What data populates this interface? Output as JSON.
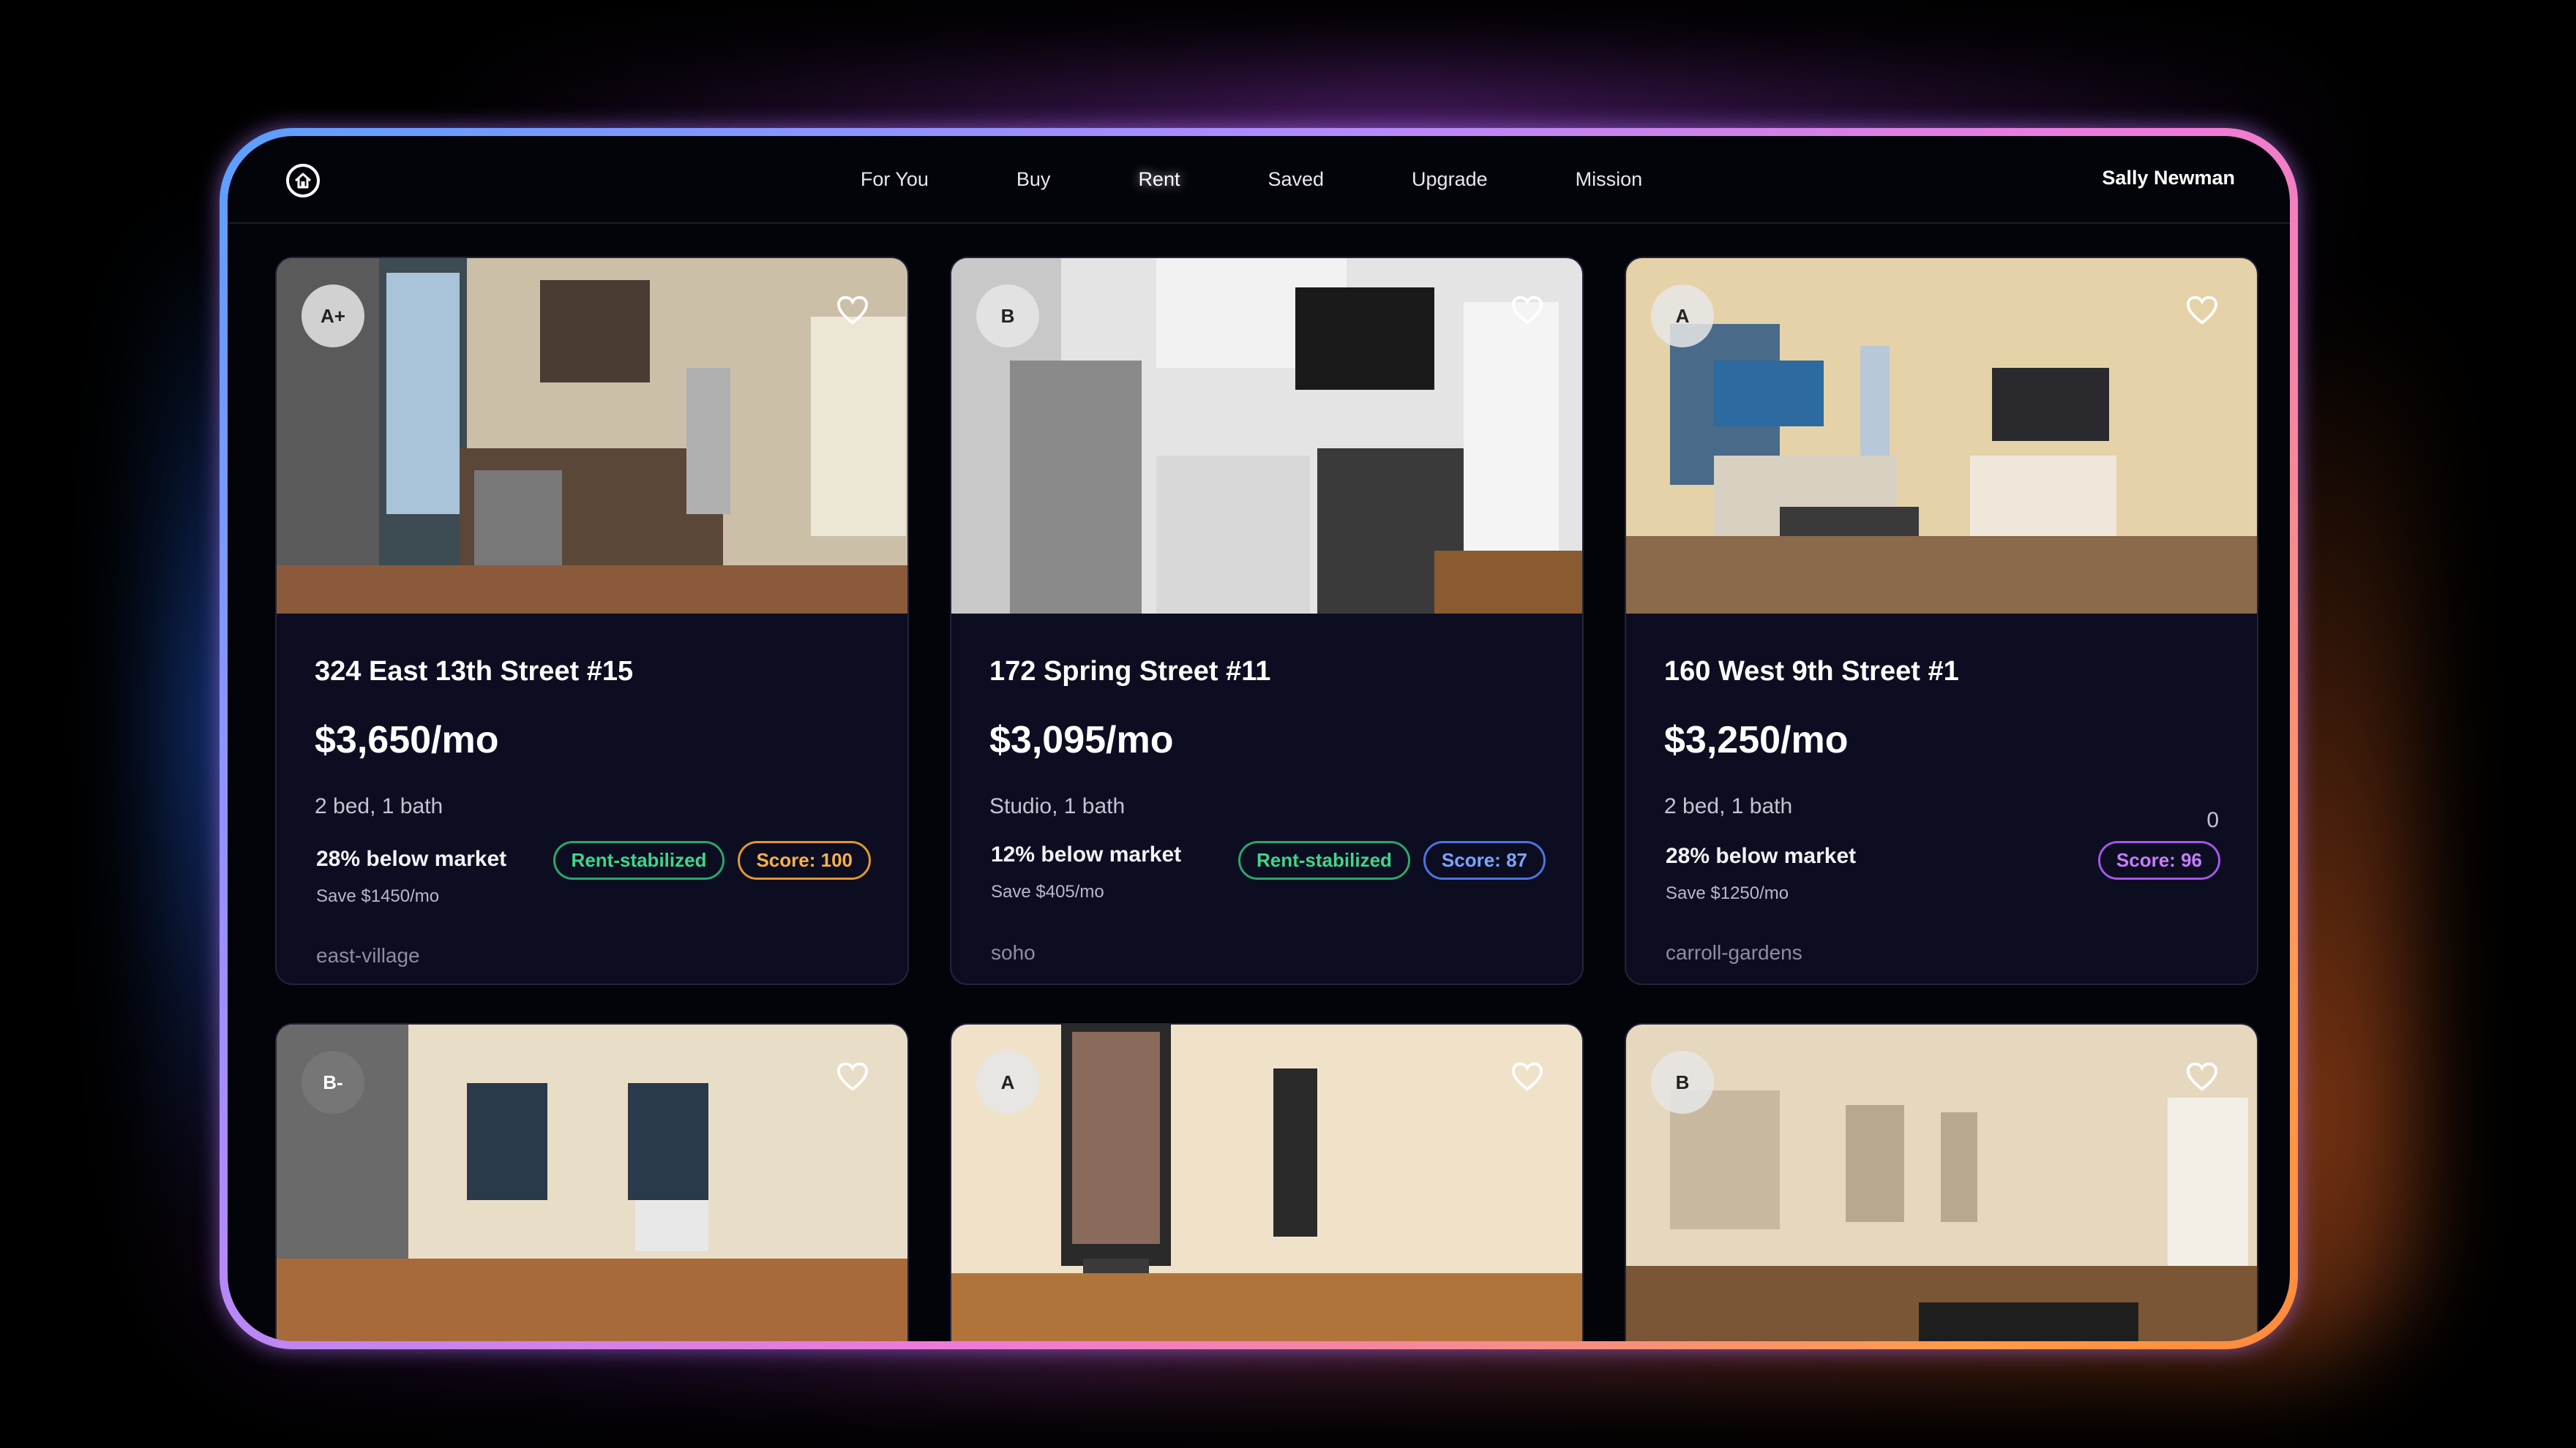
{
  "nav": {
    "items": [
      "For You",
      "Buy",
      "Rent",
      "Saved",
      "Upgrade",
      "Mission"
    ],
    "active": "Rent",
    "user": "Sally Newman"
  },
  "colors": {
    "green": "#3ed68a",
    "orange": "#f5b24a",
    "blue": "#7aa4ff",
    "purple": "#c87cff"
  },
  "listings": [
    {
      "grade": "A+",
      "address": "324 East 13th Street #15",
      "price": "$3,650/mo",
      "beds": "2 bed, 1 bath",
      "below": "28% below market",
      "save": "Save $1450/mo",
      "stabilized": "Rent-stabilized",
      "score": "Score: 100",
      "neighborhood": "east-village"
    },
    {
      "grade": "B",
      "address": "172 Spring Street #11",
      "price": "$3,095/mo",
      "beds": "Studio, 1 bath",
      "below": "12% below market",
      "save": "Save $405/mo",
      "stabilized": "Rent-stabilized",
      "score": "Score: 87",
      "neighborhood": "soho"
    },
    {
      "grade": "A",
      "address": "160 West 9th Street #1",
      "price": "$3,250/mo",
      "beds": "2 bed, 1 bath",
      "count": "0",
      "below": "28% below market",
      "save": "Save $1250/mo",
      "score": "Score: 96",
      "neighborhood": "carroll-gardens"
    },
    {
      "grade": "B-"
    },
    {
      "grade": "A"
    },
    {
      "grade": "B"
    }
  ]
}
